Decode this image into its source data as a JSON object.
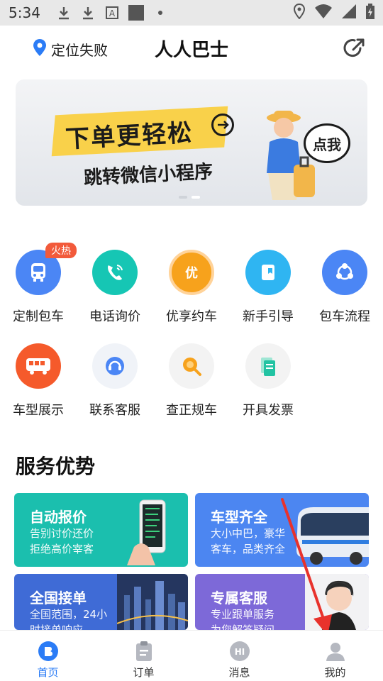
{
  "status_bar": {
    "time": "5:34",
    "icons": [
      "download-icon",
      "download-icon",
      "text-icon",
      "square-icon",
      "dot-icon",
      "location-icon",
      "wifi-icon",
      "signal-icon",
      "battery-icon"
    ]
  },
  "header": {
    "location_text": "定位失败",
    "title": "人人巴士"
  },
  "banner": {
    "headline": "下单更轻松",
    "subline": "跳转微信小程序",
    "bubble": "点我"
  },
  "grid": {
    "badge_hot": "火热",
    "items": [
      {
        "label": "定制包车",
        "color": "#4b86f5"
      },
      {
        "label": "电话询价",
        "color": "#16c6b4"
      },
      {
        "label": "优享约车",
        "color": "#f7a21c"
      },
      {
        "label": "新手引导",
        "color": "#2fb5f2"
      },
      {
        "label": "包车流程",
        "color": "#4b86f5"
      },
      {
        "label": "车型展示",
        "color": "#f55a2b"
      },
      {
        "label": "联系客服",
        "color": "#e8f0fe"
      },
      {
        "label": "查正规车",
        "color": "#fff3df"
      },
      {
        "label": "开具发票",
        "color": "#e7f8f3"
      }
    ]
  },
  "section": {
    "title": "服务优势",
    "cards": [
      {
        "title": "自动报价",
        "line1": "告别讨价还价",
        "line2": "拒绝高价宰客",
        "color": "#1bbfae"
      },
      {
        "title": "车型齐全",
        "line1": "大小中巴，豪华",
        "line2": "客车，品类齐全",
        "color": "#4c86f1"
      },
      {
        "title": "全国接单",
        "line1": "全国范围，24小",
        "line2": "时接单响应",
        "color": "#3f6bd6"
      },
      {
        "title": "专属客服",
        "line1": "专业跟单服务",
        "line2": "为您解答疑问",
        "color": "#7d69d8"
      }
    ]
  },
  "tabbar": {
    "tabs": [
      {
        "label": "首页"
      },
      {
        "label": "订单"
      },
      {
        "label": "消息"
      },
      {
        "label": "我的"
      }
    ]
  }
}
